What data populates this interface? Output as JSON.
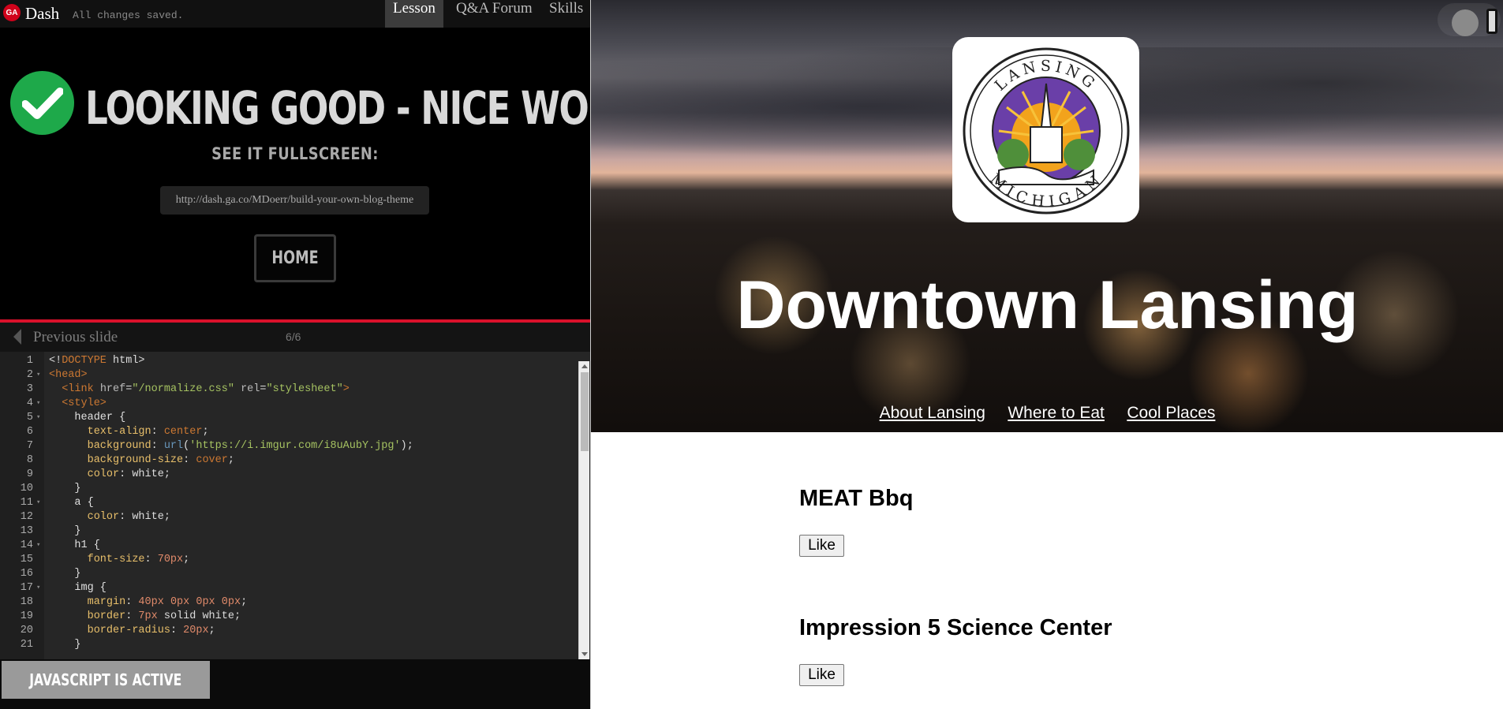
{
  "app": {
    "logo_text": "GA",
    "title": "Dash",
    "save_status": "All changes saved.",
    "tabs": [
      {
        "label": "Lesson"
      },
      {
        "label": "Q&A Forum"
      },
      {
        "label": "Skills"
      }
    ]
  },
  "success": {
    "headline": "LOOKING GOOD - NICE WORK!",
    "fullscreen_label": "SEE IT FULLSCREEN:",
    "url": "http://dash.ga.co/MDoerr/build-your-own-blog-theme",
    "home_label": "HOME"
  },
  "slide_nav": {
    "previous_label": "Previous slide",
    "counter": "6/6"
  },
  "editor": {
    "line_numbers": [
      "1",
      "2",
      "3",
      "4",
      "5",
      "6",
      "7",
      "8",
      "9",
      "10",
      "11",
      "12",
      "13",
      "14",
      "15",
      "16",
      "17",
      "18",
      "19",
      "20",
      "21"
    ]
  },
  "js_status": {
    "label": "JAVASCRIPT IS ACTIVE"
  },
  "preview": {
    "logo_top_text": "LANSING",
    "logo_bottom_text": "MICHIGAN",
    "site_title": "Downtown Lansing",
    "nav": [
      {
        "label": "About Lansing"
      },
      {
        "label": "Where to Eat"
      },
      {
        "label": "Cool Places"
      }
    ],
    "places": [
      {
        "name": "MEAT Bbq",
        "button": "Like"
      },
      {
        "name": "Impression 5 Science Center",
        "button": "Like"
      }
    ]
  },
  "colors": {
    "accent_red": "#d9112b",
    "success_green": "#1ea94a",
    "editor_bg": "#262626"
  }
}
